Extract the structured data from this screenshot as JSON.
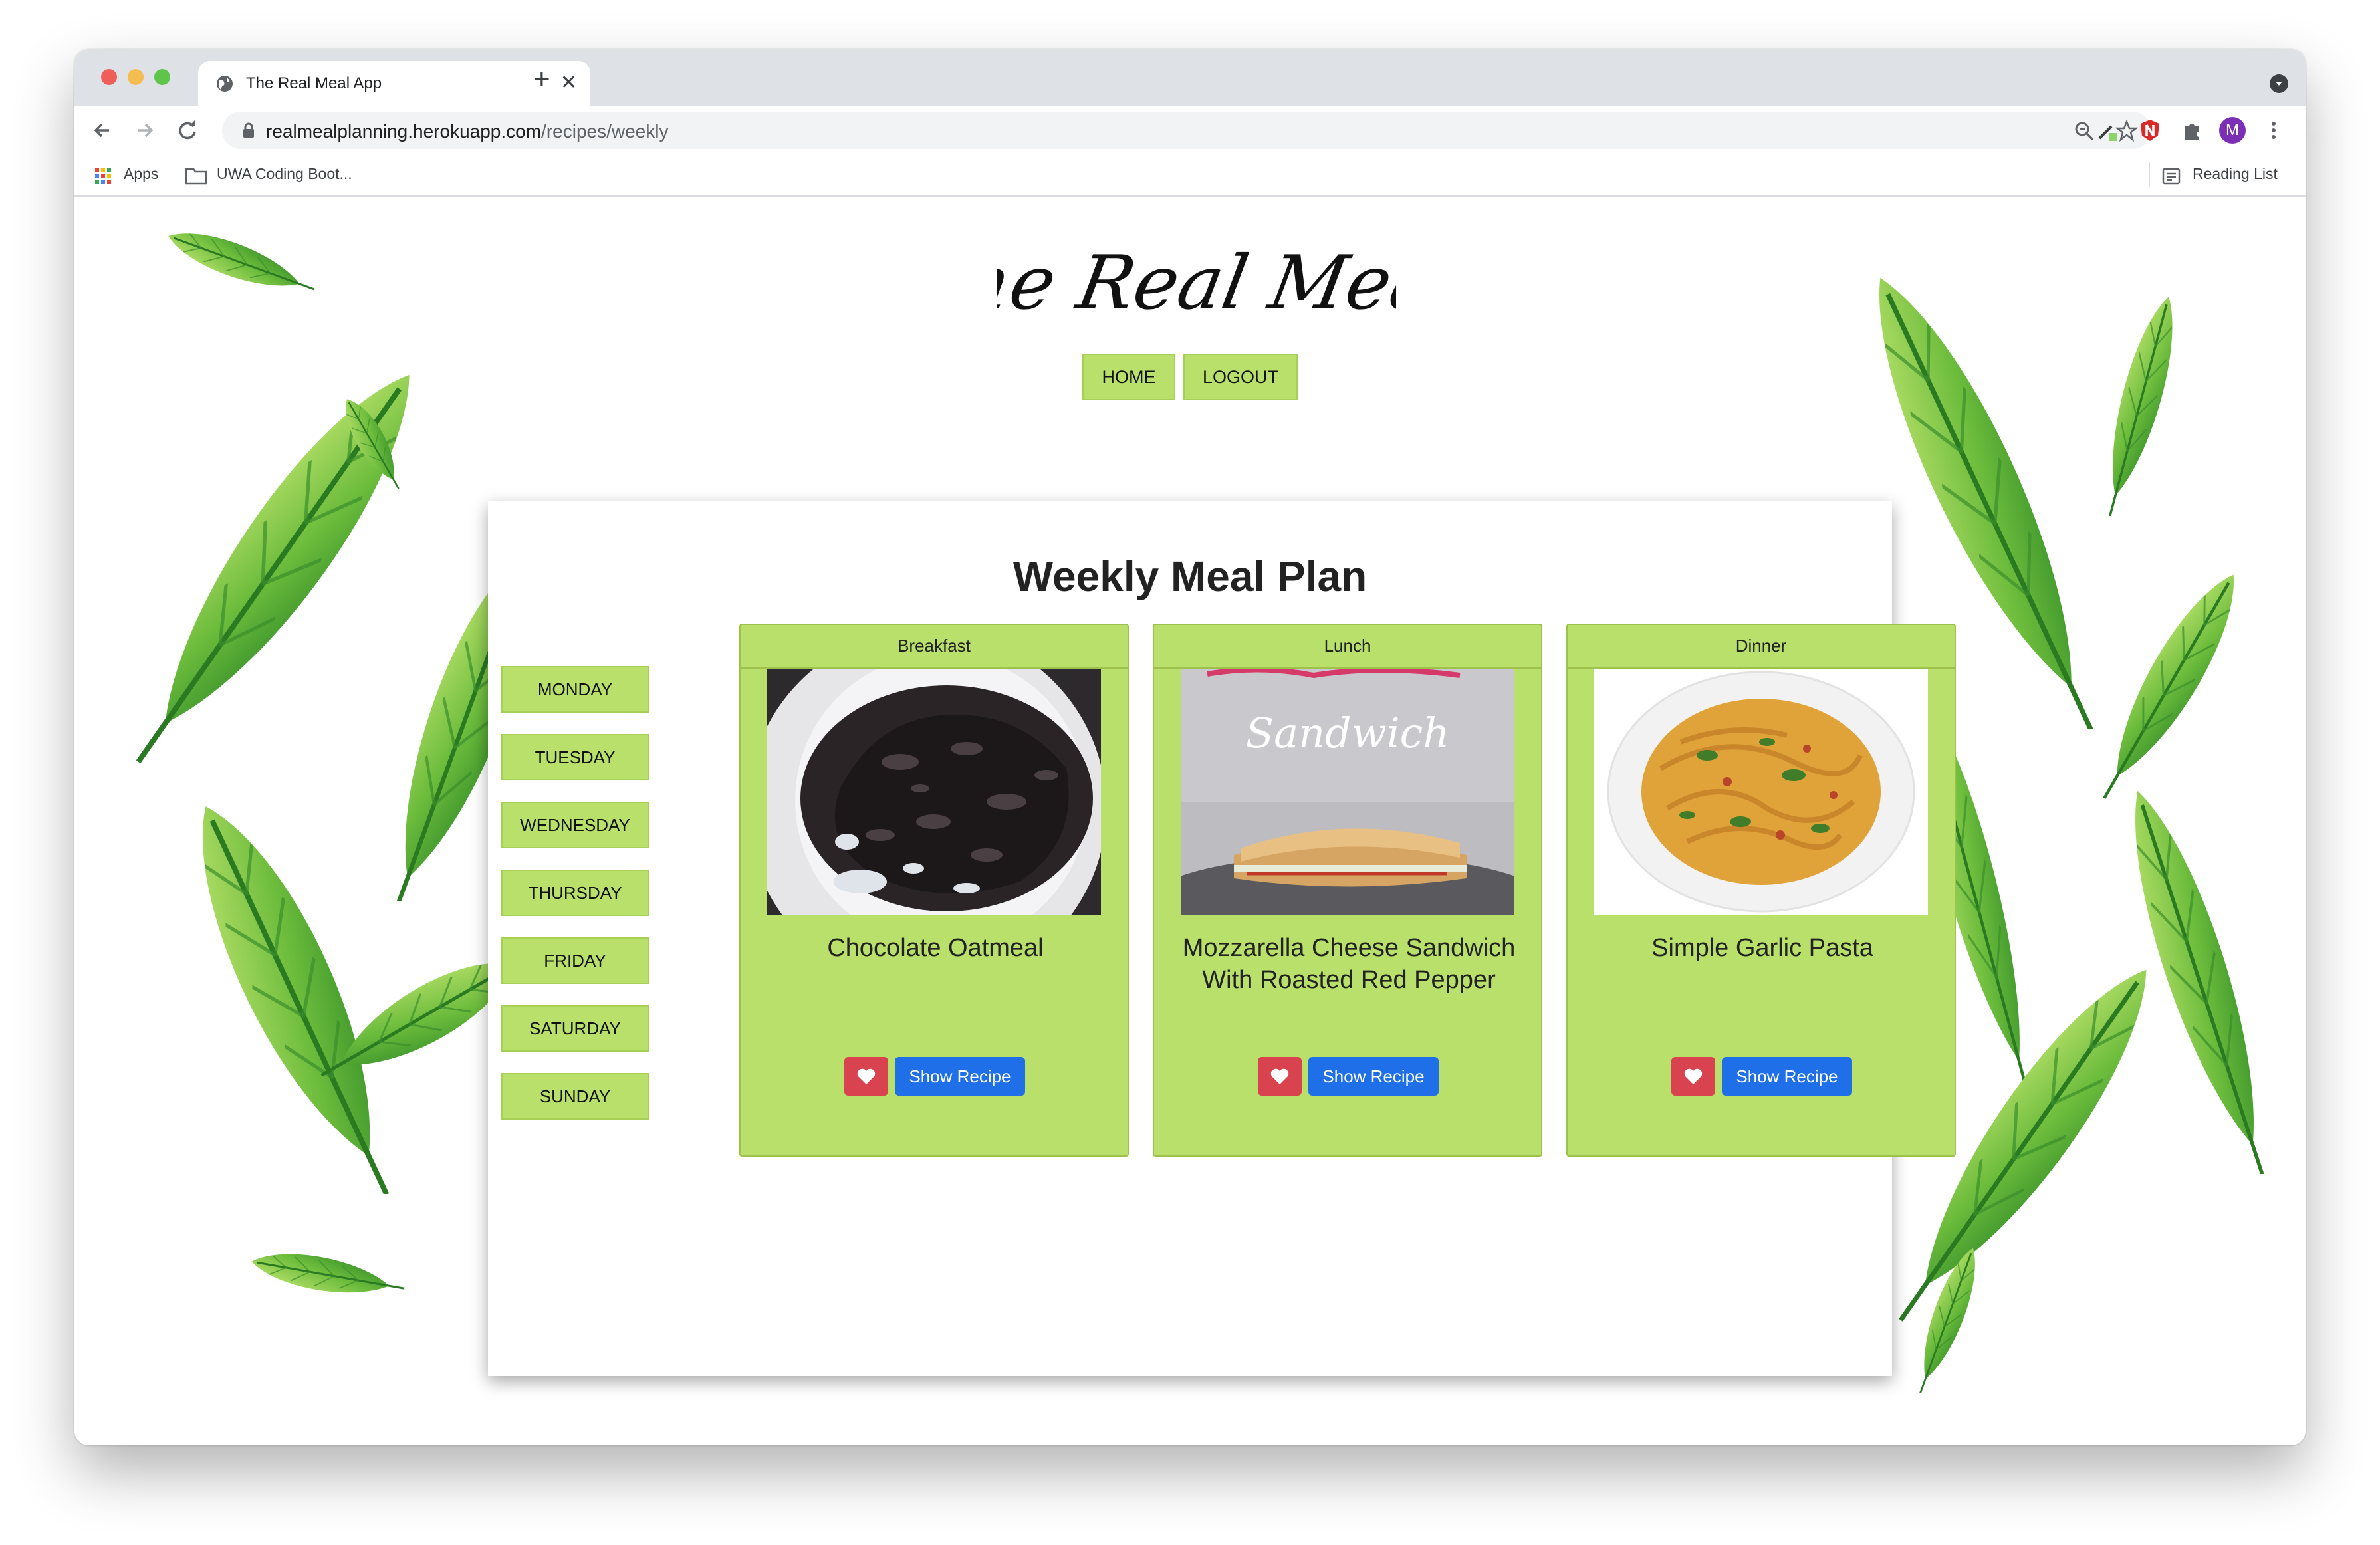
{
  "browser": {
    "tab_title": "The Real Meal App",
    "url_host": "realmealplanning.herokuapp.com",
    "url_path": "/recipes/weekly",
    "profile_initial": "M",
    "bookmarks": {
      "apps": "Apps",
      "folder": "UWA Coding Boot...",
      "reading_list": "Reading List"
    }
  },
  "site": {
    "logo_text": "The Real Meal",
    "nav": {
      "home": "HOME",
      "logout": "LOGOUT"
    }
  },
  "plan": {
    "title": "Weekly Meal Plan",
    "days": [
      "MONDAY",
      "TUESDAY",
      "WEDNESDAY",
      "THURSDAY",
      "FRIDAY",
      "SATURDAY",
      "SUNDAY"
    ],
    "meals": [
      {
        "header": "Breakfast",
        "recipe": "Chocolate Oatmeal",
        "button": "Show Recipe"
      },
      {
        "header": "Lunch",
        "recipe": "Mozzarella Cheese Sandwich With Roasted Red Pepper",
        "button": "Show Recipe",
        "image_text": "Sandwich"
      },
      {
        "header": "Dinner",
        "recipe": "Simple Garlic Pasta",
        "button": "Show Recipe"
      }
    ]
  },
  "colors": {
    "accent_green": "#b8e06a",
    "favorite_red": "#d9434f",
    "primary_blue": "#1f6fe8",
    "chrome_gray": "#dee1e6"
  },
  "icons": [
    "globe-icon",
    "close-icon",
    "plus-icon",
    "back-icon",
    "forward-icon",
    "reload-icon",
    "lock-icon",
    "zoom-icon",
    "star-icon",
    "extension-icon",
    "puzzle-icon",
    "menu-icon",
    "apps-grid-icon",
    "folder-icon",
    "reading-list-icon",
    "heart-icon"
  ]
}
